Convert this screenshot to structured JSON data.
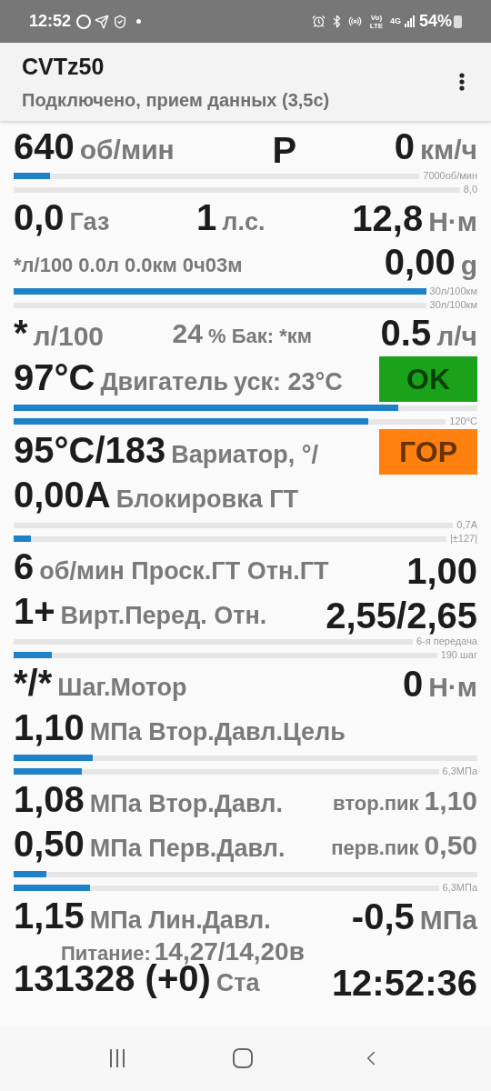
{
  "status_bar": {
    "time": "12:52",
    "volte": "Vo) LTE",
    "network": "4G",
    "battery": "54%"
  },
  "app_bar": {
    "title": "CVTz50",
    "subtitle": "Подключено, прием данных (3,5с)"
  },
  "rows": [
    {
      "groups": [
        [
          {
            "kind": "value",
            "text": "640"
          },
          {
            "kind": "unit",
            "text": "об/мин"
          }
        ],
        [
          {
            "kind": "value",
            "text": "P"
          }
        ],
        [
          {
            "kind": "value",
            "text": "0"
          },
          {
            "kind": "unit",
            "text": "км/ч"
          }
        ]
      ],
      "bars": [
        {
          "level": 0.09,
          "label": "7000об/мин"
        },
        {
          "label": "8,0"
        }
      ]
    },
    {
      "groups": [
        [
          {
            "kind": "value",
            "text": "0,0"
          },
          {
            "kind": "label",
            "text": "Газ"
          }
        ],
        [
          {
            "kind": "value",
            "text": "1"
          },
          {
            "kind": "label",
            "text": "л.с."
          }
        ],
        [
          {
            "kind": "value",
            "text": "12,8"
          },
          {
            "kind": "unit",
            "text": "Н·м"
          }
        ]
      ]
    },
    {
      "groups": [
        [
          {
            "kind": "small",
            "text": "*л/100"
          },
          {
            "kind": "small",
            "text": "0.0л"
          },
          {
            "kind": "small",
            "text": "0.0км"
          },
          {
            "kind": "small",
            "text": "0ч03м"
          }
        ],
        [
          {
            "kind": "value",
            "text": "0,00"
          },
          {
            "kind": "unit",
            "text": "g"
          }
        ]
      ],
      "bars": [
        {
          "level": 1,
          "label": "30л/100км"
        },
        {
          "label": "30л/100км"
        }
      ]
    },
    {
      "groups": [
        [
          {
            "kind": "value",
            "text": "*"
          },
          {
            "kind": "unit",
            "text": "л/100"
          }
        ],
        [
          {
            "kind": "unit",
            "text": "24"
          },
          {
            "kind": "small",
            "text": "% Бак: *км"
          }
        ],
        [
          {
            "kind": "value",
            "text": "0.5"
          },
          {
            "kind": "unit",
            "text": "л/ч"
          }
        ]
      ]
    },
    {
      "groups": [
        [
          {
            "kind": "value",
            "text": "97°C"
          },
          {
            "kind": "label",
            "text": "Двигатель"
          },
          {
            "kind": "label",
            "text": "уск: 23°C"
          }
        ]
      ],
      "badge": {
        "text": "OK",
        "color": "#1aa31a"
      },
      "bars": [
        {
          "level": 0.83
        },
        {
          "level": 0.82,
          "label": "120°C"
        }
      ]
    },
    {
      "groups": [
        [
          {
            "kind": "value",
            "text": "95°C/183"
          },
          {
            "kind": "label",
            "text": "Вариатор, °/"
          }
        ]
      ],
      "badge": {
        "text": "ГОР",
        "color": "#ff7f0f"
      }
    },
    {
      "groups": [
        [
          {
            "kind": "value",
            "text": "0,00A"
          },
          {
            "kind": "label",
            "text": "Блокировка ГТ"
          }
        ]
      ],
      "bars": [
        {
          "label": "0,7A"
        },
        {
          "level": 0.04,
          "label": "|±127|"
        }
      ]
    },
    {
      "groups": [
        [
          {
            "kind": "value",
            "text": "6"
          },
          {
            "kind": "label",
            "text": "об/мин Проск.ГТ Отн.ГТ"
          }
        ],
        [
          {
            "kind": "value",
            "text": "1,00"
          }
        ]
      ]
    },
    {
      "groups": [
        [
          {
            "kind": "value",
            "text": "1+"
          },
          {
            "kind": "label",
            "text": "Вирт.Перед. Отн."
          }
        ],
        [
          {
            "kind": "value",
            "text": "2,55/2,65"
          }
        ]
      ],
      "bars": [
        {
          "label": "6-я передача"
        },
        {
          "level": 0.09,
          "label": "190 шаг"
        }
      ]
    },
    {
      "groups": [
        [
          {
            "kind": "value",
            "text": "*/*"
          },
          {
            "kind": "label",
            "text": "Шаг.Мотор"
          }
        ],
        [
          {
            "kind": "value",
            "text": "0"
          },
          {
            "kind": "unit",
            "text": "Н·м"
          }
        ]
      ]
    },
    {
      "groups": [
        [
          {
            "kind": "value",
            "text": "1,10"
          },
          {
            "kind": "label",
            "text": "МПа Втор.Давл.Цель"
          }
        ]
      ],
      "bars": [
        {
          "level": 0.17
        },
        {
          "level": 0.16,
          "label": "6,3МПа"
        }
      ]
    },
    {
      "groups": [
        [
          {
            "kind": "value",
            "text": "1,08"
          },
          {
            "kind": "label",
            "text": "МПа Втор.Давл."
          }
        ],
        [
          {
            "kind": "small",
            "text": "втор.пик"
          },
          {
            "kind": "unit",
            "text": "1,10"
          }
        ]
      ]
    },
    {
      "groups": [
        [
          {
            "kind": "value",
            "text": "0,50"
          },
          {
            "kind": "label",
            "text": "МПа Перв.Давл."
          }
        ],
        [
          {
            "kind": "small",
            "text": "перв.пик"
          },
          {
            "kind": "unit",
            "text": "0,50"
          }
        ]
      ],
      "bars": [
        {
          "level": 0.07
        },
        {
          "level": 0.18,
          "label": "6,3МПа"
        }
      ]
    },
    {
      "groups": [
        [
          {
            "kind": "value",
            "text": "1,15"
          },
          {
            "kind": "label",
            "text": "МПа Лин.Давл."
          }
        ],
        [
          {
            "kind": "value",
            "text": "-0,5"
          },
          {
            "kind": "unit",
            "text": "МПа"
          }
        ]
      ]
    },
    {
      "groups": [
        [
          {
            "kind": "value",
            "text": "131328 (+0)"
          },
          {
            "kind": "label",
            "text": "Ста"
          }
        ],
        [
          {
            "kind": "value",
            "text": "12:52:36"
          }
        ]
      ]
    }
  ],
  "supply": {
    "label": "Питание:",
    "value": "14,27/14,20в"
  }
}
